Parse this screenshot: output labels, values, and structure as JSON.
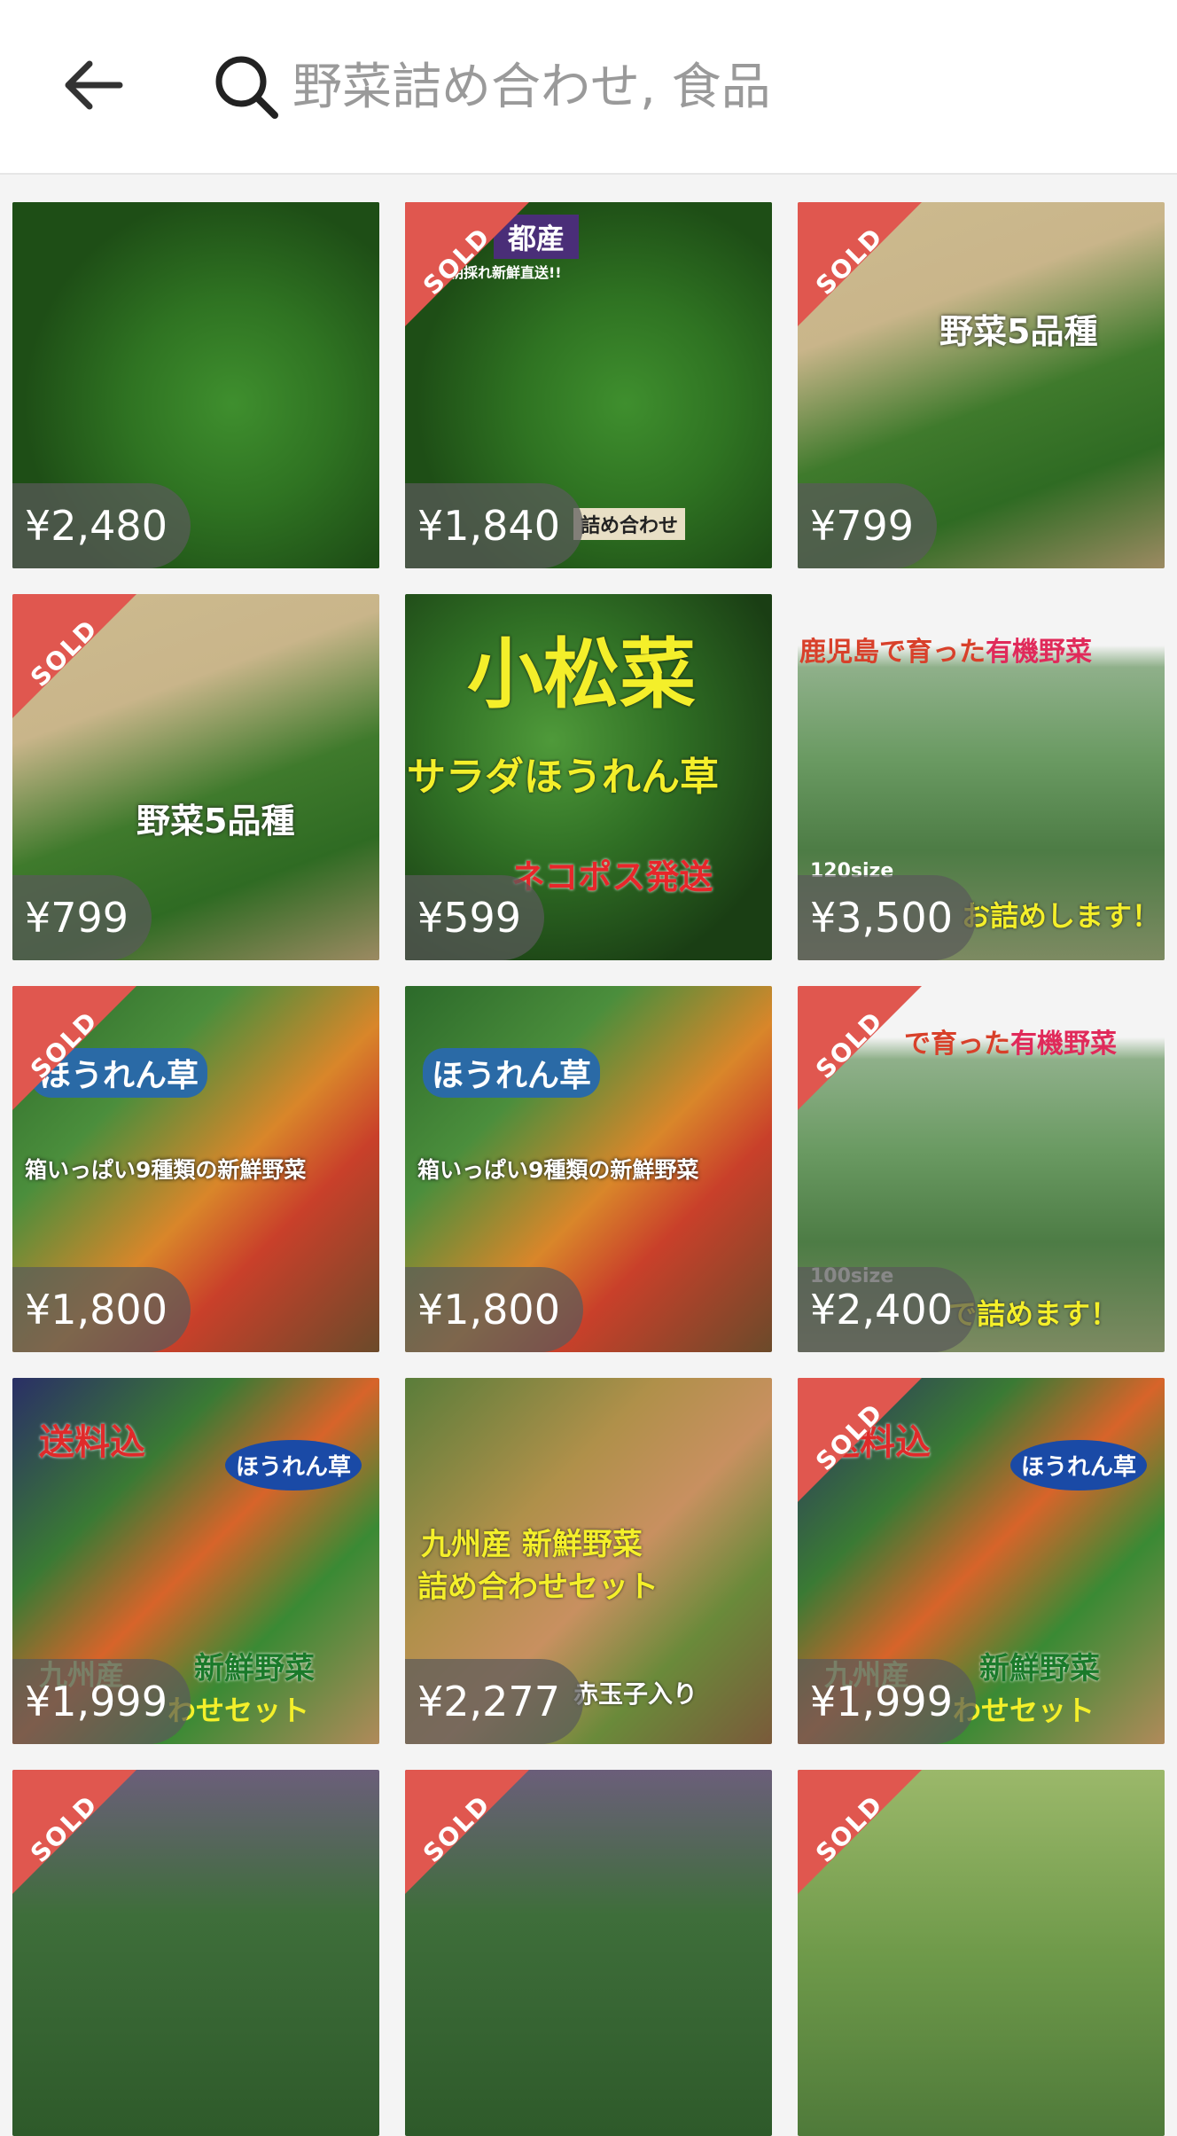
{
  "search": {
    "placeholder": "野菜詰め合わせ, 食品"
  },
  "sold_label": "SOLD",
  "items": [
    {
      "price": "¥2,480",
      "sold": false,
      "theme": "green-box",
      "banner": "",
      "bottom_text": ""
    },
    {
      "price": "¥1,840",
      "sold": true,
      "theme": "green-box",
      "banner": "都産",
      "subbanner": "朝採れ新鮮直送!!",
      "bottom_text": "詰め合わせ"
    },
    {
      "price": "¥799",
      "sold": true,
      "theme": "turnip",
      "caption": "野菜5品種"
    },
    {
      "price": "¥799",
      "sold": true,
      "theme": "turnip",
      "caption": "野菜5品種"
    },
    {
      "price": "¥599",
      "sold": false,
      "theme": "komatsuna",
      "title": "小松菜",
      "line2": "サラダほうれん草",
      "line3": "ネコポス発送"
    },
    {
      "price": "¥3,500",
      "sold": false,
      "theme": "bags",
      "header_text": "鹿児島で育った",
      "header_highlight": "有機野菜",
      "size_label": "120size",
      "bottom_text": "お詰めします！"
    },
    {
      "price": "¥1,800",
      "sold": true,
      "theme": "mixed",
      "caption": "箱いっぱい9種類の新鮮野菜",
      "badge": "ほうれん草"
    },
    {
      "price": "¥1,800",
      "sold": false,
      "theme": "mixed",
      "caption": "箱いっぱい9種類の新鮮野菜",
      "badge": "ほうれん草"
    },
    {
      "price": "¥2,400",
      "sold": true,
      "theme": "bags",
      "header_text": "で育った",
      "header_highlight": "有機野菜",
      "size_label": "100size",
      "bottom_text": "で詰めます！"
    },
    {
      "price": "¥1,999",
      "sold": false,
      "theme": "tomato",
      "top_text": "送料込",
      "badge": "ほうれん草",
      "caption": "新鮮野菜",
      "caption_left": "九州産",
      "bottom_text": "わせセット"
    },
    {
      "price": "¥2,277",
      "sold": false,
      "theme": "eggs",
      "line1": "九州産 新鮮野菜",
      "line2": "詰め合わせセット",
      "bottom_text": "赤玉子入り"
    },
    {
      "price": "¥1,999",
      "sold": true,
      "theme": "tomato",
      "top_text": "送料込",
      "badge": "ほうれん草",
      "caption": "新鮮野菜",
      "caption_left": "九州産",
      "bottom_text": "わせセット"
    },
    {
      "price": "",
      "sold": true,
      "theme": "leafy-bag"
    },
    {
      "price": "",
      "sold": true,
      "theme": "leafy-bag"
    },
    {
      "price": "",
      "sold": true,
      "theme": "flowers"
    }
  ],
  "colors": {
    "sold_ribbon": "#e0574f",
    "price_pill": "rgba(90,90,90,0.72)",
    "header_bg": "#ffffff",
    "page_bg": "#f4f4f4"
  }
}
